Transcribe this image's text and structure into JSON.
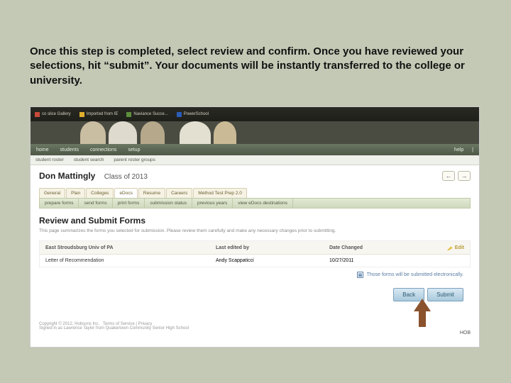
{
  "slide": {
    "instruction": "Once this step is completed, select review and confirm. Once you have reviewed your selections, hit “submit”. Your documents will be instantly transferred to the college or university."
  },
  "banner": {
    "items": [
      "co slice Gallery",
      "Imported from IE",
      "Naviance Succe...",
      "PowerSchool"
    ]
  },
  "nav": {
    "home": "home",
    "students": "students",
    "connections": "connections",
    "setup": "setup",
    "help": "help"
  },
  "subnav": {
    "a": "student roster",
    "b": "student search",
    "c": "parent roster groups"
  },
  "student": {
    "name": "Don Mattingly",
    "class": "Class of 2013"
  },
  "tabs": {
    "general": "General",
    "plan": "Plan",
    "colleges": "Colleges",
    "edocs": "eDocs",
    "resume": "Resume",
    "careers": "Careers",
    "method": "Method Test Prep 2.0"
  },
  "subtabs": {
    "prepare": "prepare forms",
    "send": "send forms",
    "print": "print forms",
    "status": "submission status",
    "prev": "previous years",
    "dest": "view eDocs destinations"
  },
  "section": {
    "heading": "Review and Submit Forms",
    "desc": "This page summarizes the forms you selected for submission. Please review them carefully and make any necessary changes prior to submitting."
  },
  "form": {
    "school": "East Stroudsburg Univ of PA",
    "col_edit": "Last edited by",
    "col_date": "Date Changed",
    "edit": "Edit",
    "doc": "Letter of Recommendation",
    "editor": "Andy Scappaticci",
    "date": "10/27/2011",
    "note": "Those forms will be submitted electronically."
  },
  "buttons": {
    "back": "Back",
    "submit": "Submit"
  },
  "footer": {
    "copy": "Copyright © 2012. Hobsons Inc.   Terms of Service | Privacy",
    "signed": "Signed in as Lawrence Taylor from Quakertown Community Senior High School",
    "hob": "HOB"
  }
}
